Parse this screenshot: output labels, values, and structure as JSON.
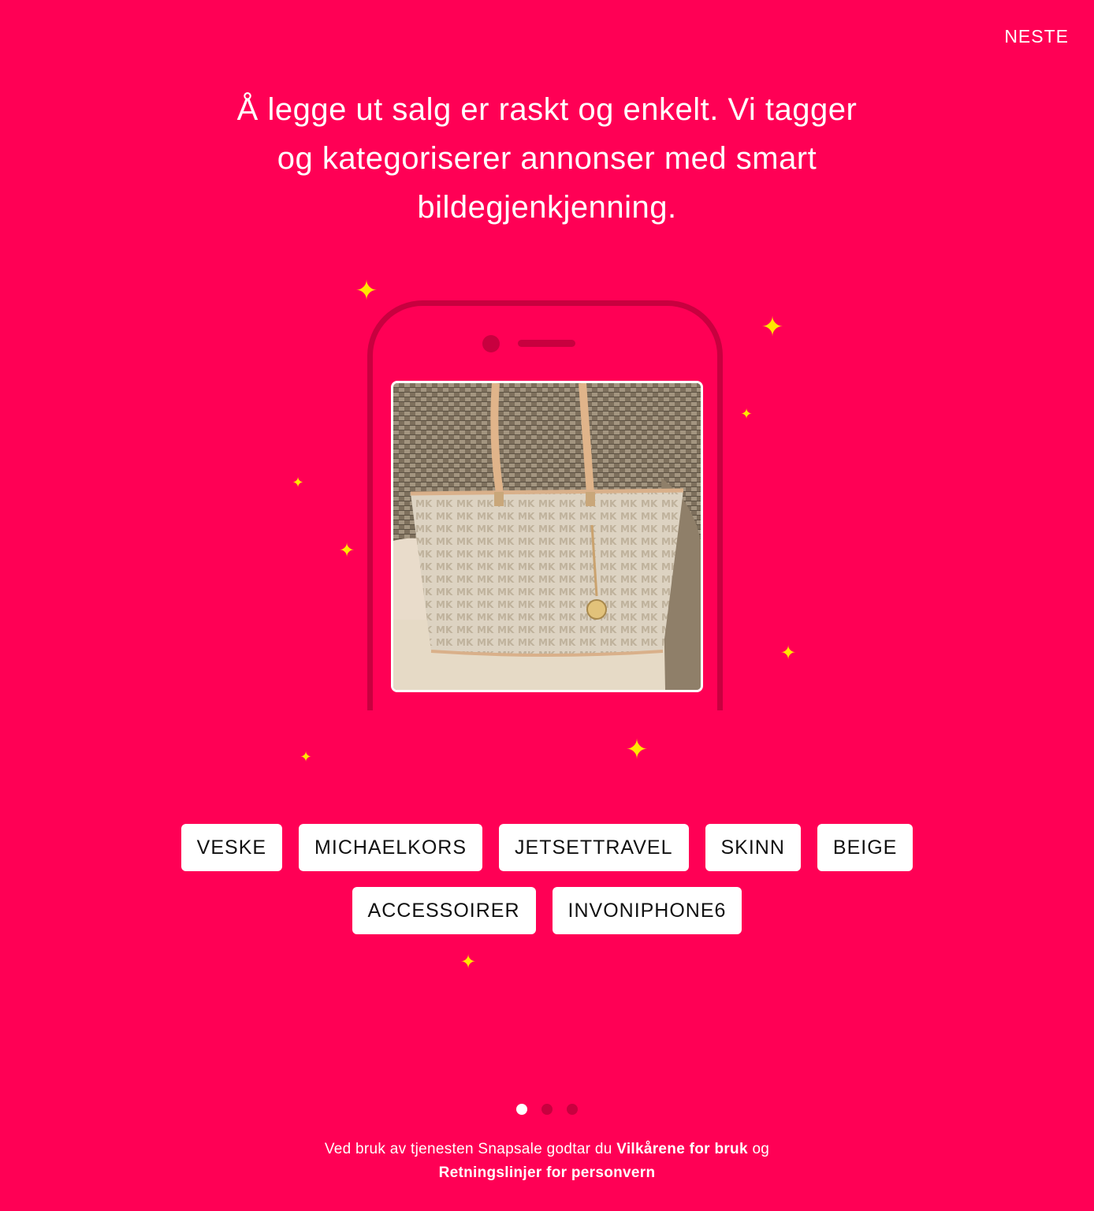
{
  "header": {
    "next_label": "NESTE"
  },
  "intro": {
    "headline": "Å legge ut salg er raskt og enkelt. Vi tagger og kategoriserer annonser med smart bildegjenkjenning."
  },
  "tags": {
    "row1": [
      "VESKE",
      "MICHAELKORS",
      "JETSETTRAVEL",
      "SKINN",
      "BEIGE"
    ],
    "row2": [
      "ACCESSOIRER",
      "INVONIPHONE6"
    ]
  },
  "pagination": {
    "total": 3,
    "active_index": 0
  },
  "legal": {
    "prefix": "Ved bruk av tjenesten Snapsale godtar du",
    "terms_link": "Vilkårene for bruk",
    "conjunction": "og",
    "privacy_link": "Retningslinjer for personvern"
  },
  "icons": {
    "sparkle": "sparkle-icon"
  },
  "colors": {
    "background": "#ff0055",
    "phone_outline": "#c8003f",
    "sparkle": "#ffe600",
    "tag_background": "#ffffff",
    "tag_text": "#111111"
  }
}
